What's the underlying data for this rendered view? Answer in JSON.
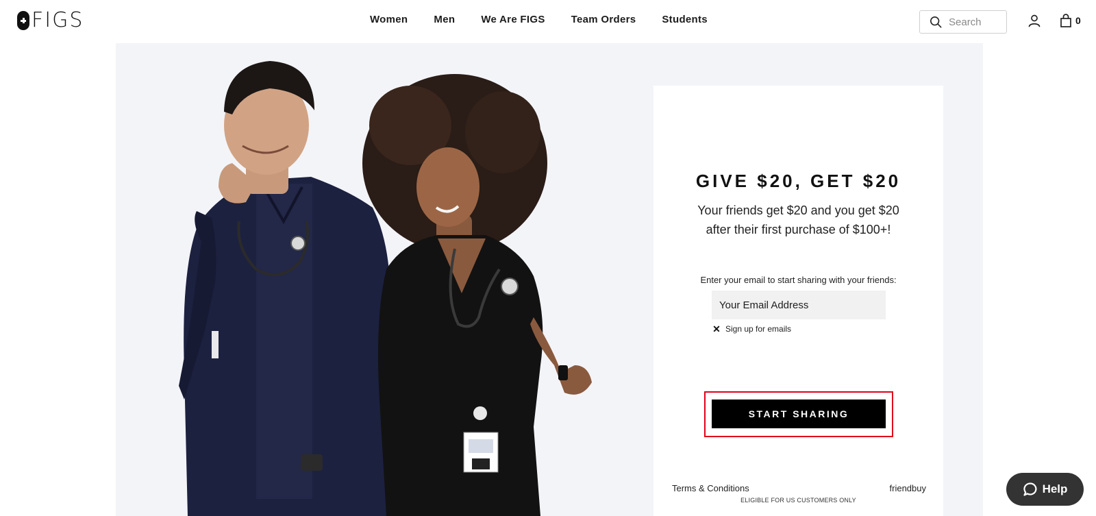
{
  "header": {
    "logo_text": "FIGS",
    "nav": [
      {
        "label": "Women"
      },
      {
        "label": "Men"
      },
      {
        "label": "We Are FIGS"
      },
      {
        "label": "Team Orders"
      },
      {
        "label": "Students"
      }
    ],
    "search": {
      "placeholder": "Search",
      "icon": "search-icon"
    },
    "account_icon": "user-icon",
    "cart": {
      "icon": "shopping-bag-icon",
      "count": "0"
    }
  },
  "hero": {
    "image_alt": "Two healthcare workers in navy and black scrubs with stethoscopes, smiling"
  },
  "referral": {
    "title": "GIVE $20, GET $20",
    "subtitle_line1": "Your friends get $20 and you get $20",
    "subtitle_line2": "after their first purchase of $100+!",
    "prompt": "Enter your email to start sharing with your friends:",
    "email_placeholder": "Your Email Address",
    "optin_mark": "✕",
    "optin_label": "Sign up for emails",
    "cta_label": "START SHARING",
    "terms_label": "Terms & Conditions",
    "brand_label": "friendbuy",
    "eligibility_note": "ELIGIBLE FOR US CUSTOMERS ONLY"
  },
  "help": {
    "label": "Help",
    "icon": "chat-bubble-icon"
  },
  "colors": {
    "hero_bg": "#f3f4f8",
    "cta_bg": "#000000",
    "highlight": "#e0001b",
    "help_bg": "#333333"
  }
}
